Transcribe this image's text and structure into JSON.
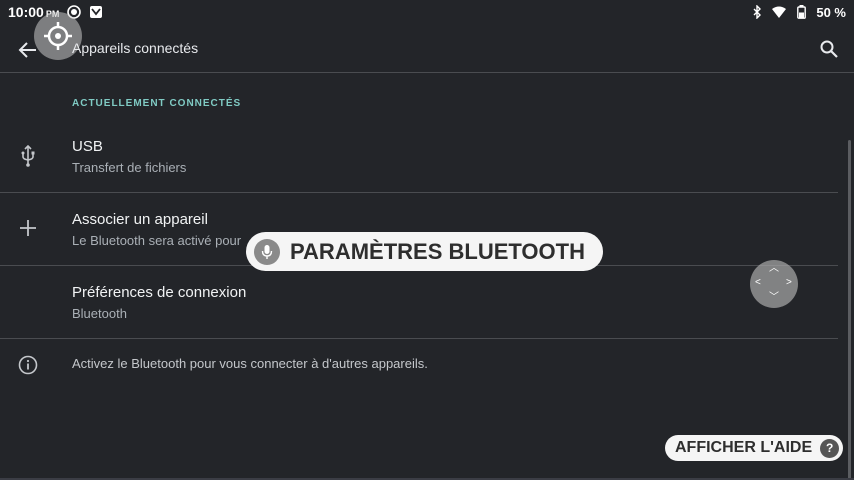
{
  "status_bar": {
    "time": "10:00",
    "ampm": "PM",
    "battery": "50 %"
  },
  "app_bar": {
    "title": "Appareils connectés"
  },
  "section": {
    "header": "ACTUELLEMENT CONNECTÉS"
  },
  "items": [
    {
      "title": "USB",
      "subtitle": "Transfert de fichiers",
      "icon": "usb-icon"
    },
    {
      "title": "Associer un appareil",
      "subtitle": "Le Bluetooth sera activé pour",
      "icon": "plus-icon"
    },
    {
      "title": "Préférences de connexion",
      "subtitle": "Bluetooth",
      "icon": ""
    }
  ],
  "info": {
    "text": "Activez le Bluetooth pour vous connecter à d'autres appareils."
  },
  "voice_overlay": {
    "label": "PARAMÈTRES BLUETOOTH"
  },
  "help": {
    "label": "AFFICHER L'AIDE",
    "badge": "?"
  },
  "colors": {
    "background": "#232529",
    "accent": "#80cbc4",
    "divider": "#4a4c50"
  }
}
